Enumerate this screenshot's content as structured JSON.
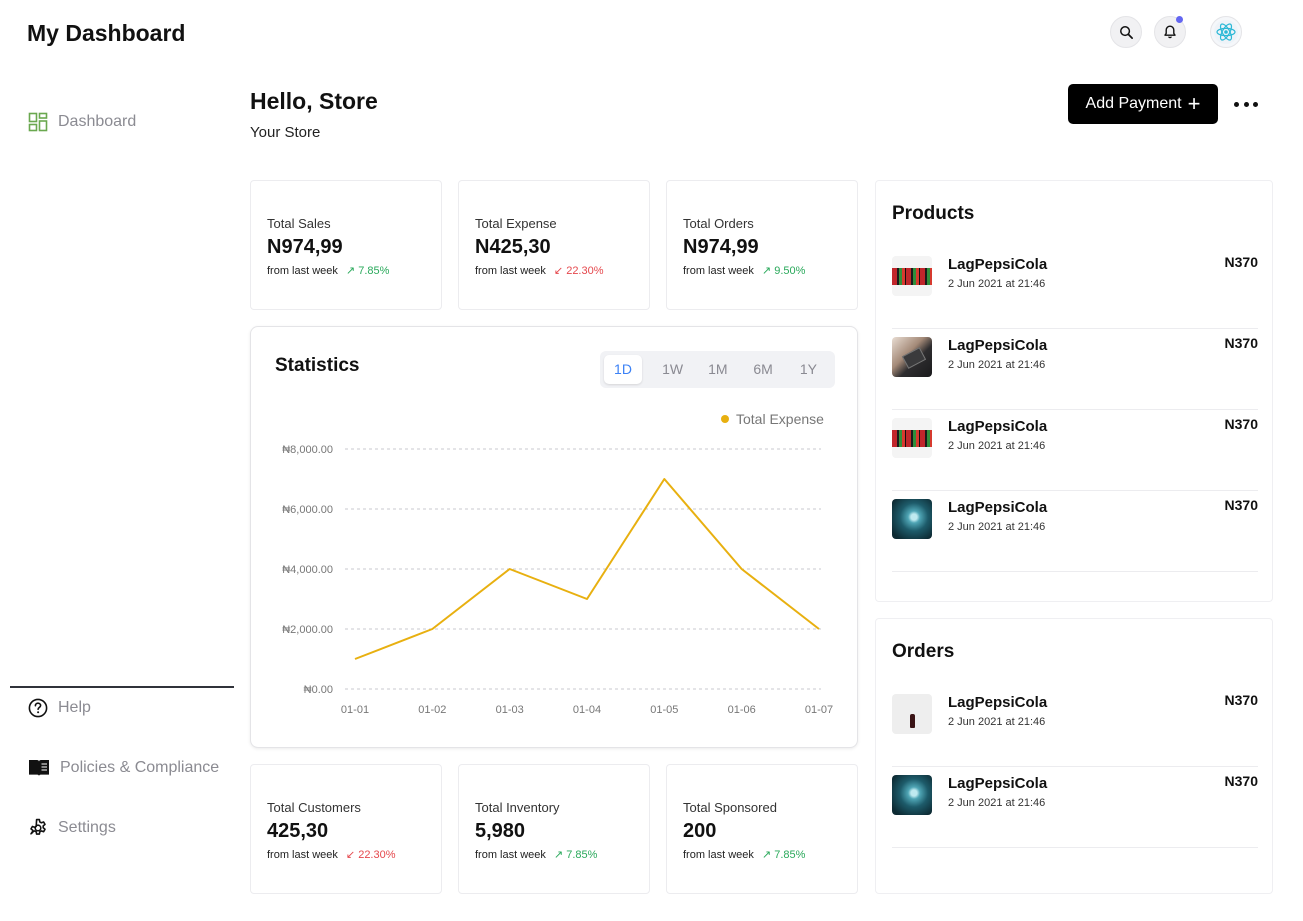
{
  "header": {
    "title": "My Dashboard"
  },
  "sidebar": {
    "items": [
      {
        "label": "Dashboard",
        "icon": "dashboard-icon",
        "active": true
      }
    ],
    "footer_items": [
      {
        "label": "Help",
        "icon": "help-icon"
      },
      {
        "label": "Policies & Compliance",
        "icon": "book-icon"
      },
      {
        "label": "Settings",
        "icon": "gear-icon"
      }
    ]
  },
  "greeting": {
    "title": "Hello, Store",
    "subtitle": "Your Store",
    "add_payment_label": "Add Payment",
    "add_payment_symbol": "+"
  },
  "top_stats": [
    {
      "label": "Total Sales",
      "value": "N974,99",
      "from": "from last week",
      "change": "↗ 7.85%",
      "trend": "up"
    },
    {
      "label": "Total Expense",
      "value": "N425,30",
      "from": "from last week",
      "change": "↙ 22.30%",
      "trend": "down"
    },
    {
      "label": "Total Orders",
      "value": "N974,99",
      "from": "from last week",
      "change": "↗ 9.50%",
      "trend": "up"
    }
  ],
  "bottom_stats": [
    {
      "label": "Total Customers",
      "value": "425,30",
      "from": "from last week",
      "change": "↙ 22.30%",
      "trend": "down"
    },
    {
      "label": "Total Inventory",
      "value": "5,980",
      "from": "from last week",
      "change": "↗ 7.85%",
      "trend": "up"
    },
    {
      "label": "Total Sponsored",
      "value": "200",
      "from": "from last week",
      "change": "↗ 7.85%",
      "trend": "up"
    }
  ],
  "statistics": {
    "title": "Statistics",
    "tabs": [
      "1D",
      "1W",
      "1M",
      "6M",
      "1Y"
    ],
    "active_tab": "1D"
  },
  "chart_data": {
    "type": "line",
    "x": [
      "01-01",
      "01-02",
      "01-03",
      "01-04",
      "01-05",
      "01-06",
      "01-07"
    ],
    "series": [
      {
        "name": "Total Expense",
        "values": [
          1000,
          2000,
          4000,
          3000,
          7000,
          4000,
          2000
        ],
        "color": "#e8b010"
      }
    ],
    "y_ticks": [
      "₦0.00",
      "₦2,000.00",
      "₦4,000.00",
      "₦6,000.00",
      "₦8,000.00"
    ],
    "ylim": [
      0,
      8000
    ],
    "grid": true,
    "legend": "top-right"
  },
  "products": {
    "title": "Products",
    "items": [
      {
        "name": "LagPepsiCola",
        "date": "2 Jun 2021 at 21:46",
        "price": "N370",
        "thumb": "cans"
      },
      {
        "name": "LagPepsiCola",
        "date": "2 Jun 2021 at 21:46",
        "price": "N370",
        "thumb": "dark-can"
      },
      {
        "name": "LagPepsiCola",
        "date": "2 Jun 2021 at 21:46",
        "price": "N370",
        "thumb": "cans"
      },
      {
        "name": "LagPepsiCola",
        "date": "2 Jun 2021 at 21:46",
        "price": "N370",
        "thumb": "teal"
      }
    ]
  },
  "orders": {
    "title": "Orders",
    "items": [
      {
        "name": "LagPepsiCola",
        "date": "2 Jun 2021 at 21:46",
        "price": "N370",
        "thumb": "bottle"
      },
      {
        "name": "LagPepsiCola",
        "date": "2 Jun 2021 at 21:46",
        "price": "N370",
        "thumb": "teal"
      }
    ]
  },
  "colors": {
    "accent": "#6366f1",
    "up": "#2aa95b",
    "down": "#e5484d",
    "sidebar_active": "#6aa84f",
    "chart_line": "#e8b010",
    "tab_active": "#3c82f6"
  }
}
